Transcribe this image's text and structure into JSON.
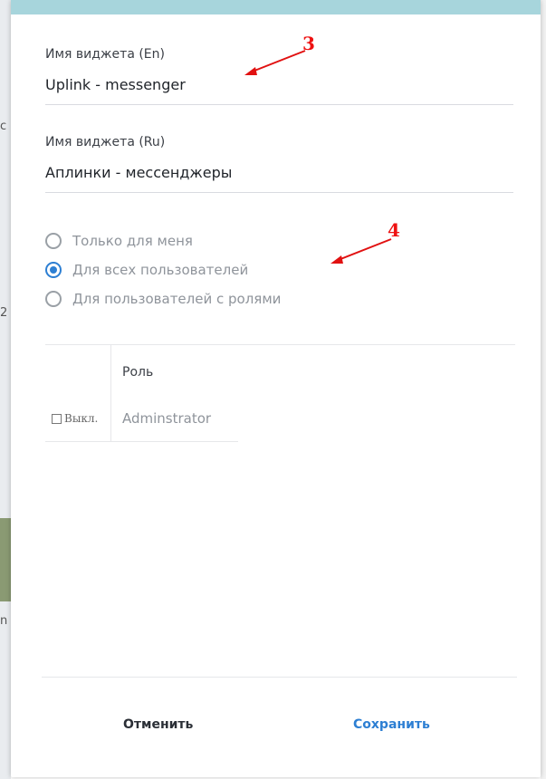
{
  "background": {
    "edge_chars": [
      "c",
      "2",
      "n"
    ]
  },
  "form": {
    "name_en": {
      "label": "Имя виджета (En)",
      "value": "Uplink - messenger"
    },
    "name_ru": {
      "label": "Имя виджета (Ru)",
      "value": "Аплинки - мессенджеры"
    }
  },
  "visibility": {
    "options": [
      {
        "label": "Только для меня",
        "checked": false
      },
      {
        "label": "Для всех пользователей",
        "checked": true
      },
      {
        "label": "Для пользователей с ролями",
        "checked": false
      }
    ]
  },
  "roles_table": {
    "header_role": "Роль",
    "rows": [
      {
        "toggle_label": "Выкл.",
        "role": "Adminstrator"
      }
    ]
  },
  "footer": {
    "cancel_label": "Отменить",
    "save_label": "Сохранить"
  },
  "annotations": {
    "marker_3": "3",
    "marker_4": "4"
  },
  "colors": {
    "accent": "#2d7fd3",
    "annotation": "#e11111",
    "modal_top": "#a7d5dc"
  }
}
